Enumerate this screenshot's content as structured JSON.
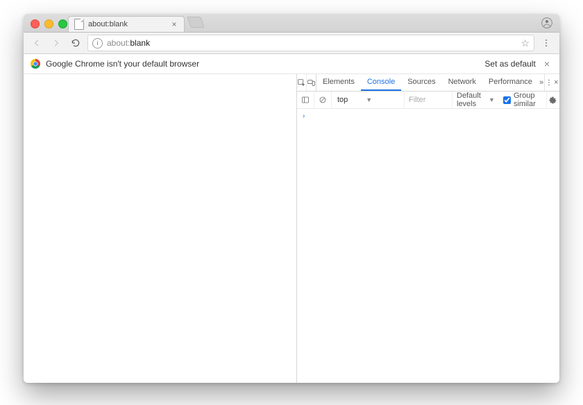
{
  "tab": {
    "title": "about:blank",
    "close_glyph": "×"
  },
  "omnibox": {
    "info_glyph": "i",
    "host": "about:",
    "path": "blank",
    "star_glyph": "☆"
  },
  "infobar": {
    "message": "Google Chrome isn't your default browser",
    "action": "Set as default",
    "dismiss_glyph": "×"
  },
  "devtools": {
    "tabs": {
      "elements": "Elements",
      "console": "Console",
      "sources": "Sources",
      "network": "Network",
      "performance": "Performance",
      "more_glyph": "»",
      "close_glyph": "×",
      "active": "console"
    },
    "console_bar": {
      "context": "top",
      "context_caret": "▼",
      "filter_placeholder": "Filter",
      "levels_label": "Default levels",
      "levels_caret": "▼",
      "group_similar_label": "Group similar",
      "group_similar_checked": true
    },
    "prompt_glyph": "›"
  }
}
